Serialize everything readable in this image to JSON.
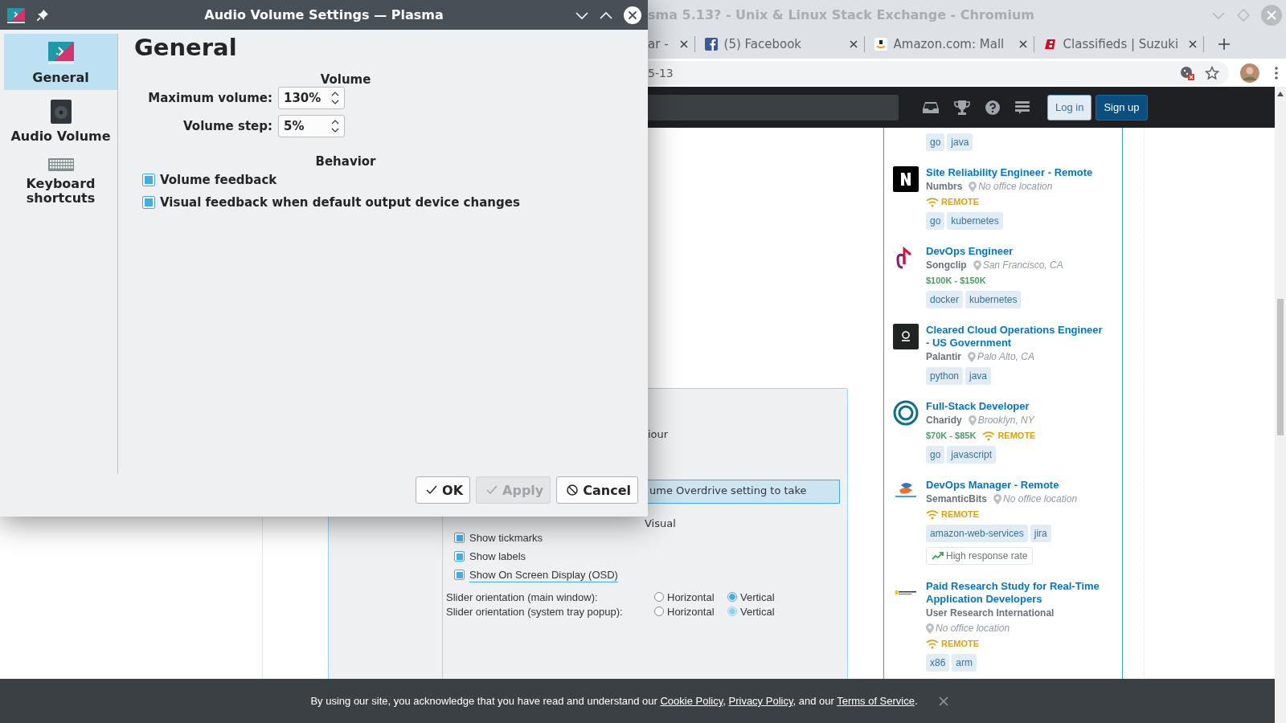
{
  "browser": {
    "title": "sma 5.13? - Unix & Linux Stack Exchange - Chromium",
    "tabs": [
      {
        "label": "ar -",
        "selected": false
      },
      {
        "label": "(5) Facebook",
        "selected": false
      },
      {
        "label": "Amazon.com: Mall",
        "selected": false
      },
      {
        "label": "Classifieds | Suzuki",
        "selected": false
      }
    ],
    "address": "5-13",
    "topbar_buttons": [
      {
        "kind": "secondary",
        "label": "Log in"
      },
      {
        "kind": "primary",
        "label": "Sign up"
      }
    ],
    "post_image": {
      "fragment": "iour",
      "highlight": "ume Overdrive setting to take",
      "visual_heading": "Visual",
      "checkboxes": [
        {
          "label": "Show tickmarks",
          "checked": true,
          "focused": false
        },
        {
          "label": "Show labels",
          "checked": true,
          "focused": false
        },
        {
          "label": "Show On Screen Display (OSD)",
          "checked": true,
          "focused": true
        }
      ],
      "radio_rows": [
        {
          "label": "Slider orientation (main window):",
          "options": [
            {
              "label": "Horizontal",
              "selected": false
            },
            {
              "label": "Vertical",
              "selected": true
            }
          ]
        },
        {
          "label": "Slider orientation (system tray popup):",
          "options": [
            {
              "label": "Horizontal",
              "selected": false
            },
            {
              "label": "Vertical",
              "selected": true
            }
          ]
        }
      ]
    },
    "jobs": [
      {
        "tags": [
          "go",
          "java"
        ]
      },
      {
        "title": "Site Reliability Engineer - Remote",
        "company": "Numbrs",
        "location": "No office location",
        "remote": "REMOTE",
        "tags": [
          "go",
          "kubernetes"
        ]
      },
      {
        "title": "DevOps Engineer",
        "company": "Songclip",
        "location": "San Francisco, CA",
        "salary": "$100K - $150K",
        "tags": [
          "docker",
          "kubernetes"
        ]
      },
      {
        "title": "Cleared Cloud Operations Engineer - US Government",
        "company": "Palantir",
        "location": "Palo Alto, CA",
        "tags": [
          "python",
          "java"
        ]
      },
      {
        "title": "Full-Stack Developer",
        "company": "Charidy",
        "location": "Brooklyn, NY",
        "salary": "$70K - $85K",
        "remote": "REMOTE",
        "tags": [
          "go",
          "javascript"
        ]
      },
      {
        "title": "DevOps Manager - Remote",
        "company": "SemanticBits",
        "location": "No office location",
        "remote": "REMOTE",
        "tags": [
          "amazon-web-services",
          "jira"
        ],
        "badge": "High response rate"
      },
      {
        "title": "Paid Research Study for Real-Time Application Developers",
        "company": "User Research International",
        "location": "No office location",
        "remote": "REMOTE",
        "tags": [
          "x86",
          "arm"
        ]
      }
    ],
    "cookie_banner": [
      {
        "text": "By using our site, you acknowledge that you have read and understand our ",
        "link": false
      },
      {
        "text": "Cookie Policy",
        "link": true
      },
      {
        "text": ", ",
        "link": false
      },
      {
        "text": "Privacy Policy",
        "link": true
      },
      {
        "text": ", and our ",
        "link": false
      },
      {
        "text": "Terms of Service",
        "link": true
      },
      {
        "text": ".",
        "link": false
      }
    ]
  },
  "dialog": {
    "title": "Audio Volume Settings — Plasma",
    "sidebar": [
      {
        "kind": "general",
        "label": "General",
        "selected": true
      },
      {
        "kind": "speaker",
        "label": "Audio Volume",
        "selected": false
      },
      {
        "kind": "keyboard",
        "label": "Keyboard shortcuts",
        "selected": false
      }
    ],
    "heading": "General",
    "sections": [
      {
        "title": "Volume",
        "rows": [
          {
            "kind": "spinbox",
            "label": "Maximum volume:",
            "value": "130%"
          },
          {
            "kind": "spinbox",
            "label": "Volume step:",
            "value": "5%"
          }
        ]
      },
      {
        "title": "Behavior",
        "rows": [
          {
            "kind": "checkbox",
            "label": "Volume feedback",
            "checked": true
          },
          {
            "kind": "checkbox",
            "label": "Visual feedback when default output device changes",
            "checked": true
          }
        ]
      }
    ],
    "buttons": [
      {
        "kind": "ok",
        "label": "OK",
        "disabled": false
      },
      {
        "kind": "apply",
        "label": "Apply",
        "disabled": true
      },
      {
        "kind": "cancel",
        "label": "Cancel",
        "disabled": false
      }
    ]
  }
}
